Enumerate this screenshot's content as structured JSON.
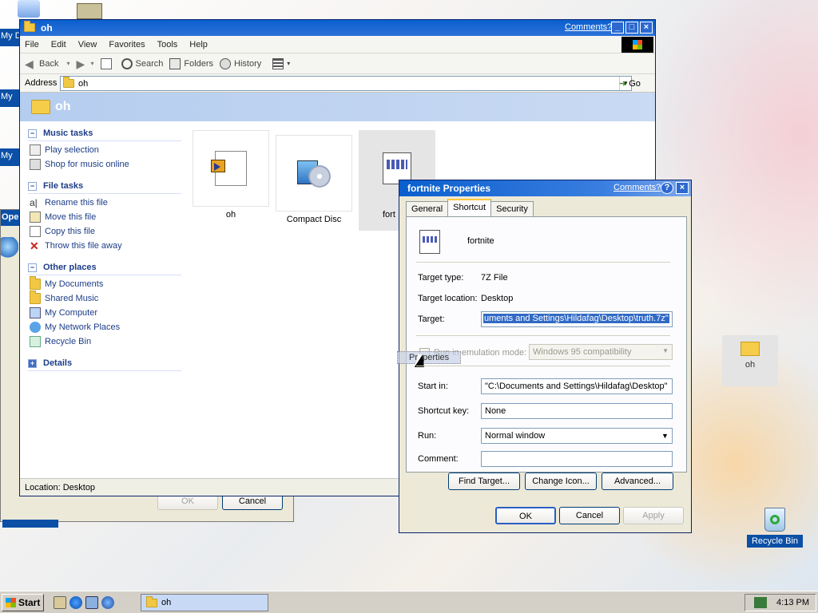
{
  "desktop": {
    "icons": {
      "my_documents_partial": "My D",
      "my_partial_1": "My",
      "my_partial_2": "My",
      "open_partial": "Oper",
      "oh_folder": "oh",
      "recycle_bin": "Recycle Bin"
    },
    "colors": {
      "selection": "#0b4fa6",
      "title": "#0a5fce"
    }
  },
  "behind_dialog": {
    "ok_label": "OK",
    "cancel_label": "Cancel"
  },
  "explorer": {
    "title": "oh",
    "comments_link": "Comments?",
    "menu": [
      "File",
      "Edit",
      "View",
      "Favorites",
      "Tools",
      "Help"
    ],
    "toolbar": {
      "back": "Back",
      "search": "Search",
      "folders": "Folders",
      "history": "History"
    },
    "address": {
      "label": "Address",
      "value": "oh",
      "go": "Go"
    },
    "banner_title": "oh",
    "task_sections": [
      {
        "title": "Music tasks",
        "items": [
          "Play selection",
          "Shop for music online"
        ]
      },
      {
        "title": "File tasks",
        "items": [
          "Rename this file",
          "Move this file",
          "Copy this file",
          "Throw this file away"
        ]
      },
      {
        "title": "Other places",
        "items": [
          "My Documents",
          "Shared Music",
          "My Computer",
          "My Network Places",
          "Recycle Bin"
        ]
      },
      {
        "title": "Details",
        "items": []
      }
    ],
    "files": [
      {
        "name": "oh"
      },
      {
        "name": "Compact Disc"
      },
      {
        "name": "fort"
      }
    ],
    "status": "Location: Desktop"
  },
  "properties": {
    "title": "fortnite Properties",
    "comments_link": "Comments?",
    "tabs": [
      "General",
      "Shortcut",
      "Security"
    ],
    "file_name": "fortnite",
    "target_type_label": "Target type:",
    "target_type_value": "7Z File",
    "target_location_label": "Target location:",
    "target_location_value": "Desktop",
    "target_label": "Target:",
    "target_value": "uments and Settings\\Hildafag\\Desktop\\truth.7z\"",
    "emulation_label": "Run in emulation mode:",
    "emulation_value": "Windows 95 compatibility",
    "drag_tooltip": "Properties",
    "start_in_label": "Start in:",
    "start_in_value": "\"C:\\Documents and Settings\\Hildafag\\Desktop\"",
    "shortcut_key_label": "Shortcut key:",
    "shortcut_key_value": "None",
    "run_label": "Run:",
    "run_value": "Normal window",
    "comment_label": "Comment:",
    "comment_value": "",
    "find_target": "Find Target...",
    "change_icon": "Change Icon...",
    "advanced": "Advanced...",
    "ok": "OK",
    "cancel": "Cancel",
    "apply": "Apply"
  },
  "taskbar": {
    "start": "Start",
    "task_button": "oh",
    "clock": "4:13 PM"
  }
}
